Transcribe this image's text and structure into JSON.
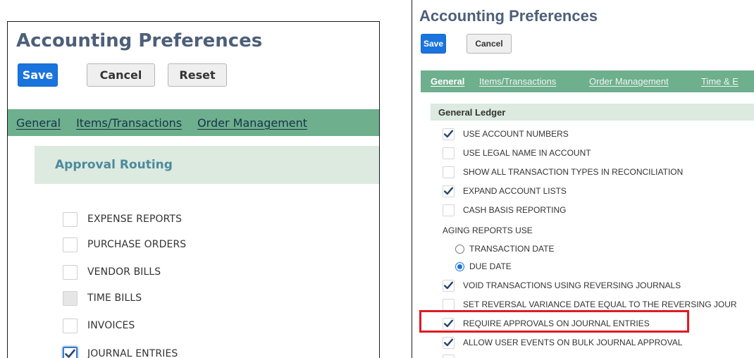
{
  "left": {
    "title": "Accounting Preferences",
    "buttons": {
      "save": "Save",
      "cancel": "Cancel",
      "reset": "Reset"
    },
    "tabs": [
      "General",
      "Items/Transactions",
      "Order Management"
    ],
    "section_title": "Approval Routing",
    "items": [
      {
        "label": "EXPENSE REPORTS",
        "checked": false,
        "disabled": false
      },
      {
        "label": "PURCHASE ORDERS",
        "checked": false,
        "disabled": false
      },
      {
        "label": "VENDOR BILLS",
        "checked": false,
        "disabled": false
      },
      {
        "label": "TIME BILLS",
        "checked": false,
        "disabled": true
      },
      {
        "label": "INVOICES",
        "checked": false,
        "disabled": false
      },
      {
        "label": "JOURNAL ENTRIES",
        "checked": true,
        "disabled": false
      }
    ]
  },
  "right": {
    "title": "Accounting Preferences",
    "buttons": {
      "save": "Save",
      "cancel": "Cancel"
    },
    "tabs": [
      "General",
      "Items/Transactions",
      "Order Management",
      "Time & E"
    ],
    "active_tab": "General",
    "section_title": "General Ledger",
    "items": [
      {
        "label": "USE ACCOUNT NUMBERS",
        "checked": true
      },
      {
        "label": "USE LEGAL NAME IN ACCOUNT",
        "checked": false
      },
      {
        "label": "SHOW ALL TRANSACTION TYPES IN RECONCILIATION",
        "checked": false
      },
      {
        "label": "EXPAND ACCOUNT LISTS",
        "checked": true
      },
      {
        "label": "CASH BASIS REPORTING",
        "checked": false
      }
    ],
    "aging_label": "AGING REPORTS USE",
    "radios": [
      {
        "label": "TRANSACTION DATE",
        "selected": false
      },
      {
        "label": "DUE DATE",
        "selected": true
      }
    ],
    "items2": [
      {
        "label": "VOID TRANSACTIONS USING REVERSING JOURNALS",
        "checked": true
      },
      {
        "label": "SET REVERSAL VARIANCE DATE EQUAL TO THE REVERSING JOUR",
        "checked": false
      },
      {
        "label": "REQUIRE APPROVALS ON JOURNAL ENTRIES",
        "checked": true
      },
      {
        "label": "ALLOW USER EVENTS ON BULK JOURNAL APPROVAL",
        "checked": true
      }
    ],
    "highlight_color": "#e01a22"
  },
  "colors": {
    "primary_button": "#1a74dd",
    "tab_bar": "#6eaf8d",
    "section_band": "#dceadf",
    "title": "#4d5f79",
    "checkmark": "#23466f"
  }
}
